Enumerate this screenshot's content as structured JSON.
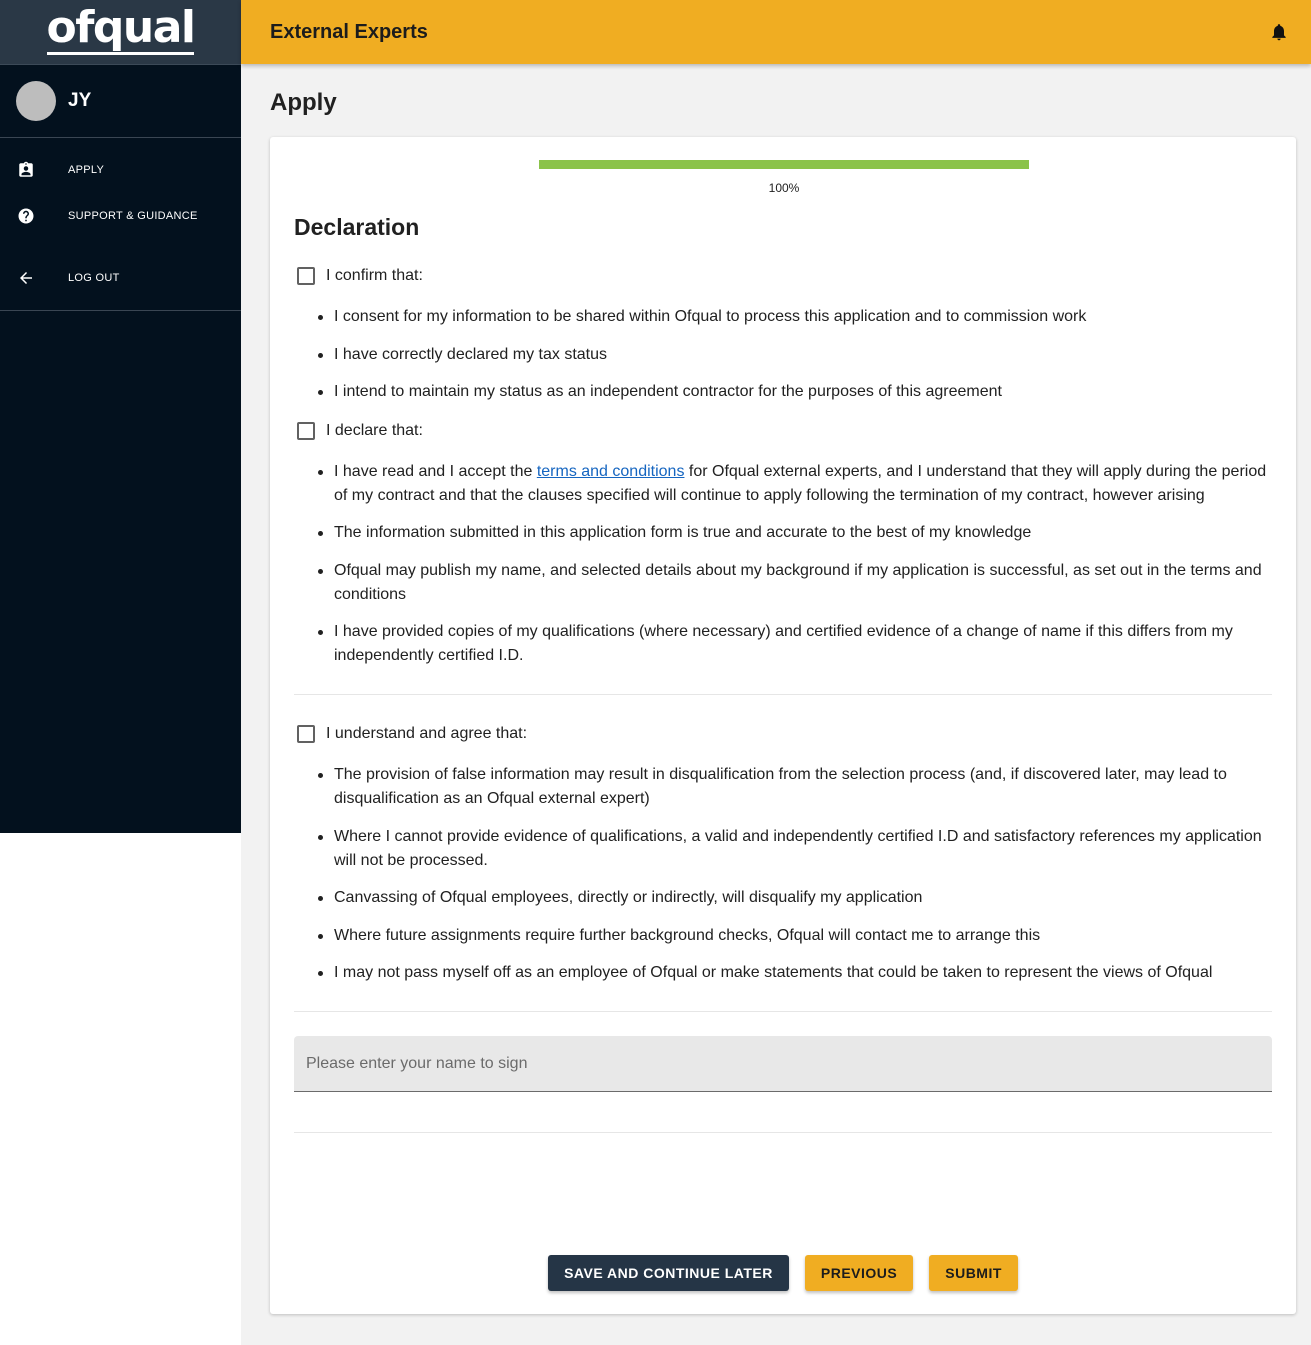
{
  "app": {
    "logo_text": "ofqual",
    "title": "External Experts"
  },
  "colors": {
    "header": "#f0ad22",
    "sidebar": "#03111e",
    "progress": "#8bc34a",
    "primary_dark": "#253546"
  },
  "icons": {
    "notifications": "bell-icon",
    "apply": "assignment-ind-icon",
    "support": "help-circle-icon",
    "logout": "arrow-left-icon"
  },
  "user": {
    "initials": "JY"
  },
  "sidebar": {
    "items": [
      {
        "label": "APPLY",
        "icon": "assignment-ind-icon"
      },
      {
        "label": "SUPPORT & GUIDANCE",
        "icon": "help-circle-icon"
      },
      {
        "label": "LOG OUT",
        "icon": "arrow-left-icon"
      }
    ]
  },
  "page": {
    "title": "Apply"
  },
  "progress": {
    "value": 1.0,
    "label": "100%"
  },
  "declaration": {
    "heading": "Declaration",
    "confirm": {
      "label": "I confirm that:",
      "items": [
        "I consent for my information to be shared within Ofqual to process this application and to commission work",
        "I have correctly declared my tax status",
        "I intend to maintain my status as an independent contractor for the purposes of this agreement"
      ]
    },
    "declare": {
      "label": "I declare that:",
      "first_item_before_link": "I have read and I accept the ",
      "link_text": "terms and conditions",
      "first_item_after_link": " for Ofqual external experts, and I understand that they will apply during the period of my contract and that the clauses specified will continue to apply following the termination of my contract, however arising",
      "items": [
        "The information submitted in this application form is true and accurate to the best of my knowledge",
        "Ofqual may publish my name, and selected details about my background if my application is successful, as set out in the terms and conditions",
        "I have provided copies of my qualifications (where necessary) and certified evidence of a change of name if this differs from my independently certified I.D."
      ]
    },
    "agree": {
      "label": "I understand and agree that:",
      "items": [
        "The provision of false information may result in disqualification from the selection process (and, if discovered later, may lead to disqualification as an Ofqual external expert)",
        "Where I cannot provide evidence of qualifications, a valid and independently certified I.D and satisfactory references my application will not be processed.",
        "Canvassing of Ofqual employees, directly or indirectly, will disqualify my application",
        "Where future assignments require further background checks, Ofqual will contact me to arrange this",
        "I may not pass myself off as an employee of Ofqual or make statements that could be taken to represent the views of Ofqual"
      ]
    },
    "signature": {
      "placeholder": "Please enter your name to sign",
      "value": ""
    }
  },
  "buttons": {
    "save_later": "SAVE AND CONTINUE LATER",
    "previous": "PREVIOUS",
    "submit": "SUBMIT"
  }
}
